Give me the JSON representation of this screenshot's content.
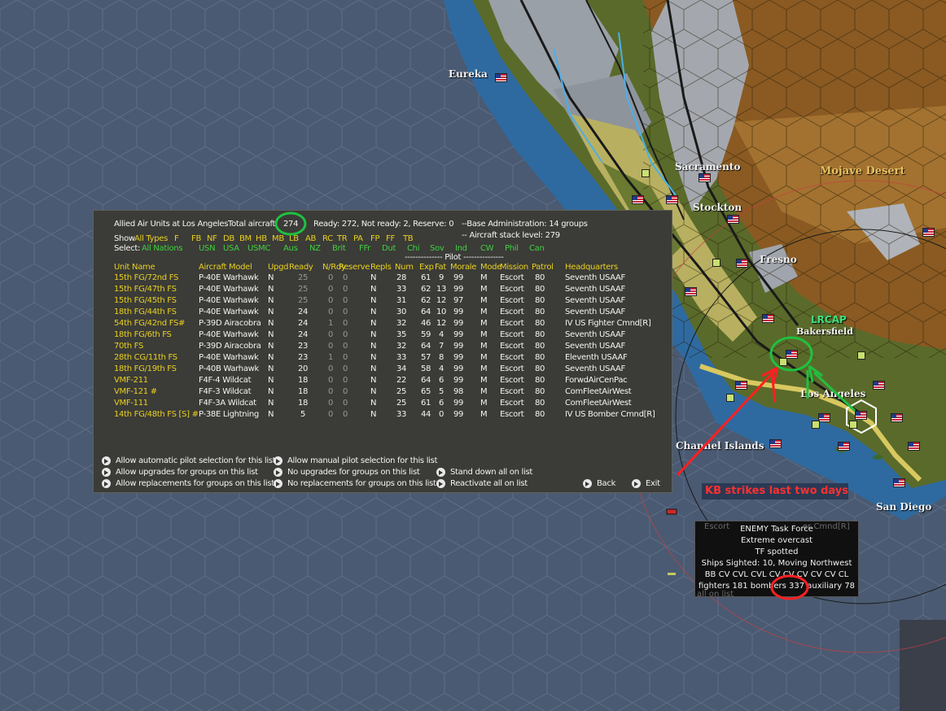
{
  "map": {
    "labels": {
      "eureka": "Eureka",
      "sacramento": "Sacramento",
      "stockton": "Stockton",
      "mojave": "Mojave Desert",
      "fresno": "Fresno",
      "bakersfield": "Bakersfield",
      "los_angeles": "Los Angeles",
      "channel_islands": "Channel Islands",
      "san_diego": "San Diego"
    }
  },
  "annotations": {
    "lrcap": "LRCAP",
    "kb_strikes": "KB strikes last two days"
  },
  "panel": {
    "title": "Allied Air Units at Los Angeles",
    "total_label": "Total aircraft:",
    "total_value": "274",
    "ready_text": "Ready: 272, Not ready: 2, Reserve: 0",
    "base_admin": "--Base Administration: 14 groups",
    "stack_level": "-- Aircraft stack level: 279",
    "show_label": "Show",
    "show_types": [
      "All Types",
      "F",
      "FB",
      "NF",
      "DB",
      "BM",
      "HB",
      "MB",
      "LB",
      "AB",
      "RC",
      "TR",
      "PA",
      "FP",
      "FF",
      "TB"
    ],
    "select_label": "Select:",
    "nations": [
      "All Nations",
      "USN",
      "USA",
      "USMC",
      "Aus",
      "NZ",
      "Brit",
      "FFr",
      "Dut",
      "Chi",
      "Sov",
      "Ind",
      "CW",
      "Phil",
      "Can"
    ],
    "pilot_header": "-------------- Pilot ---------------",
    "columns": [
      "Unit Name",
      "Aircraft Model",
      "Upgd",
      "Ready",
      "N/Rdy",
      "Reserve",
      "Repls",
      "Num",
      "Exp",
      "Fat",
      "Morale",
      "Mode",
      "Mission",
      "Patrol",
      "Headquarters"
    ],
    "rows": [
      [
        "15th FG/72nd FS",
        "P-40E Warhawk",
        "N",
        "25",
        "0",
        "0",
        "N",
        "28",
        "61",
        "9",
        "99",
        "M",
        "Escort",
        "80",
        "Seventh USAAF"
      ],
      [
        "15th FG/47th FS",
        "P-40E Warhawk",
        "N",
        "25",
        "0",
        "0",
        "N",
        "33",
        "62",
        "13",
        "99",
        "M",
        "Escort",
        "80",
        "Seventh USAAF"
      ],
      [
        "15th FG/45th FS",
        "P-40E Warhawk",
        "N",
        "25",
        "0",
        "0",
        "N",
        "31",
        "62",
        "12",
        "97",
        "M",
        "Escort",
        "80",
        "Seventh USAAF"
      ],
      [
        "18th FG/44th FS",
        "P-40E Warhawk",
        "N",
        "24",
        "0",
        "0",
        "N",
        "30",
        "64",
        "10",
        "99",
        "M",
        "Escort",
        "80",
        "Seventh USAAF"
      ],
      [
        "54th FG/42nd FS#",
        "P-39D Airacobra",
        "N",
        "24",
        "1",
        "0",
        "N",
        "32",
        "46",
        "12",
        "99",
        "M",
        "Escort",
        "80",
        "IV US Fighter Cmnd[R]"
      ],
      [
        "18th FG/6th FS",
        "P-40E Warhawk",
        "N",
        "24",
        "0",
        "0",
        "N",
        "35",
        "59",
        "4",
        "99",
        "M",
        "Escort",
        "80",
        "Seventh USAAF"
      ],
      [
        "70th FS",
        "P-39D Airacobra",
        "N",
        "23",
        "0",
        "0",
        "N",
        "32",
        "64",
        "7",
        "99",
        "M",
        "Escort",
        "80",
        "Seventh USAAF"
      ],
      [
        "28th CG/11th FS",
        "P-40E Warhawk",
        "N",
        "23",
        "1",
        "0",
        "N",
        "33",
        "57",
        "8",
        "99",
        "M",
        "Escort",
        "80",
        "Eleventh USAAF"
      ],
      [
        "18th FG/19th FS",
        "P-40B Warhawk",
        "N",
        "20",
        "0",
        "0",
        "N",
        "34",
        "58",
        "4",
        "99",
        "M",
        "Escort",
        "80",
        "Seventh USAAF"
      ],
      [
        "VMF-211",
        "F4F-4 Wildcat",
        "N",
        "18",
        "0",
        "0",
        "N",
        "22",
        "64",
        "6",
        "99",
        "M",
        "Escort",
        "80",
        "ForwdAirCenPac"
      ],
      [
        "VMF-121 #",
        "F4F-3 Wildcat",
        "N",
        "18",
        "0",
        "0",
        "N",
        "25",
        "65",
        "5",
        "98",
        "M",
        "Escort",
        "80",
        "ComFleetAirWest"
      ],
      [
        "VMF-111",
        "F4F-3A Wildcat",
        "N",
        "18",
        "0",
        "0",
        "N",
        "25",
        "61",
        "6",
        "99",
        "M",
        "Escort",
        "80",
        "ComFleetAirWest"
      ],
      [
        "14th FG/48th FS [S] #",
        "P-38E Lightning",
        "N",
        "5",
        "0",
        "0",
        "N",
        "33",
        "44",
        "0",
        "99",
        "M",
        "Escort",
        "80",
        "IV US Bomber Cmnd[R]"
      ]
    ],
    "commands": {
      "allow_auto_pilot": "Allow automatic pilot selection for this list",
      "allow_manual_pilot": "Allow manual pilot selection for this list",
      "allow_upgrades": "Allow upgrades for groups on this list",
      "no_upgrades": "No upgrades for groups on this list",
      "stand_down": "Stand down all on list",
      "allow_replacements": "Allow replacements for groups on this list",
      "no_replacements": "No replacements for groups on this list",
      "reactivate": "Reactivate all on list",
      "back": "Back",
      "exit": "Exit"
    }
  },
  "task_force": {
    "title": "ENEMY Task Force",
    "weather": "Extreme overcast",
    "status": "TF spotted",
    "sighted": "Ships Sighted: 10, Moving Northwest",
    "ships": "BB CV CVL CVL CV CV CV CV CV CL",
    "fighters": "fighters 181",
    "bombers": "bombers 337",
    "auxiliary": "auxiliary 78"
  },
  "colors": {
    "ocean": "#4a5a72",
    "coast": "#2e6aa0",
    "panel_bg": "#3b3b37",
    "header_yellow": "#e8d020",
    "nation_green": "#40d040",
    "annotation_red": "#ff2020",
    "annotation_green": "#20c040"
  }
}
